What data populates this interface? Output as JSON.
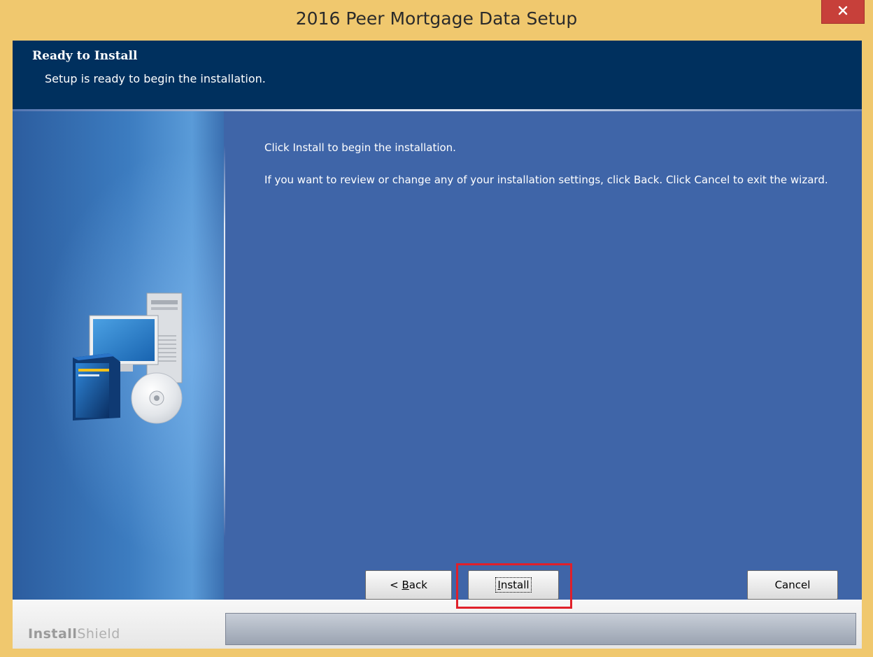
{
  "window": {
    "title": "2016 Peer Mortgage Data Setup",
    "close_glyph": "×"
  },
  "header": {
    "title": "Ready to Install",
    "subtitle": "Setup is ready to begin the installation."
  },
  "content": {
    "line1": "Click Install to begin the installation.",
    "line2": "If you want to review or change any of your installation settings, click Back. Click Cancel to exit the wizard."
  },
  "footer": {
    "brand_bold": "Install",
    "brand_thin": "Shield"
  },
  "buttons": {
    "back_prefix": "< ",
    "back_accel": "B",
    "back_rest": "ack",
    "install_accel": "I",
    "install_rest": "nstall",
    "cancel": "Cancel"
  },
  "colors": {
    "frame": "#f0c86e",
    "header_bg": "#00305e",
    "content_bg": "#3f65a8",
    "highlight": "#e0202a",
    "close_button": "#c7403a"
  },
  "icons": {
    "illustration": "computer-setup-icon",
    "close": "close-icon"
  }
}
